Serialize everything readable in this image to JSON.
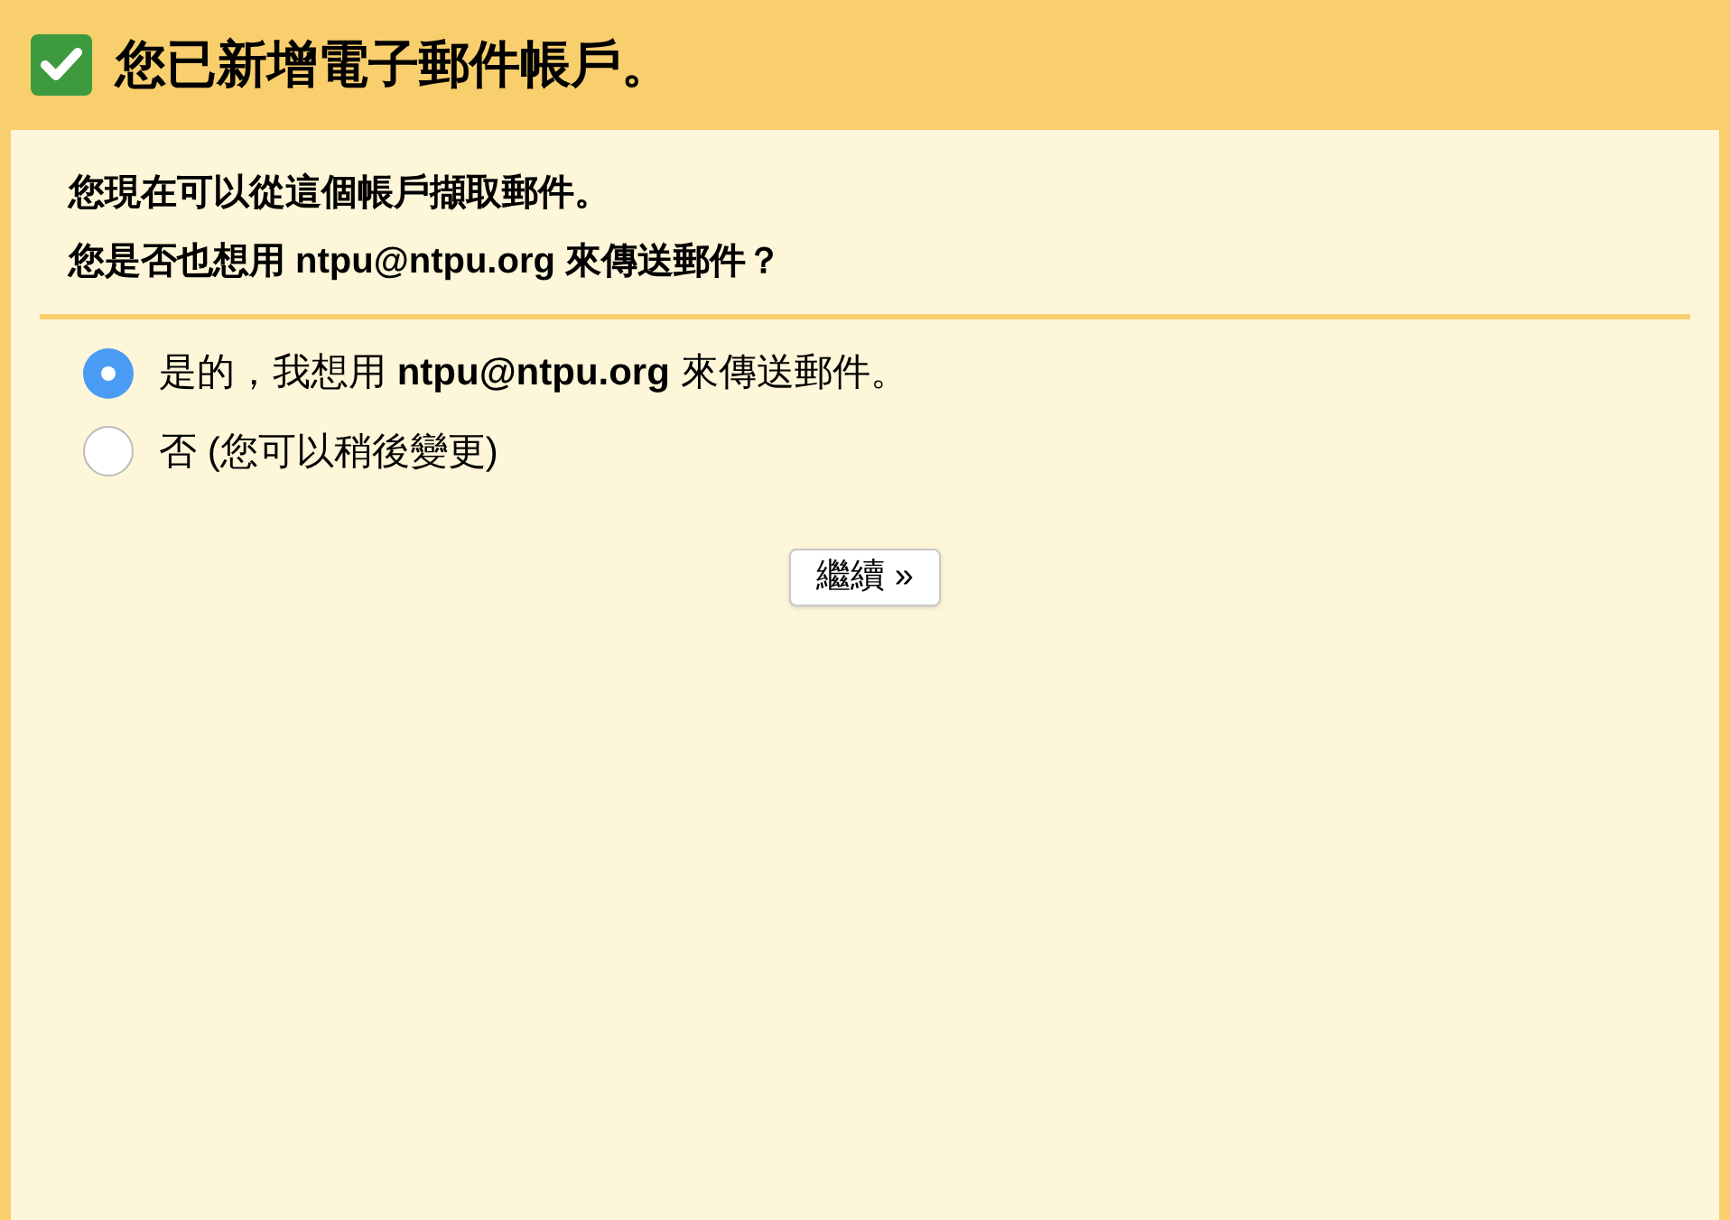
{
  "header": {
    "title": "您已新增電子郵件帳戶。"
  },
  "message": [
    "您現在可以從這個帳戶擷取郵件。",
    "您是否也想用 ntpu@ntpu.org 來傳送郵件？"
  ],
  "options": [
    {
      "label": "是的，我想用 **ntpu@ntpu.org** 來傳送郵件。",
      "selected": true
    },
    {
      "label": "否 (您可以稍後變更)",
      "selected": false
    }
  ],
  "button": {
    "label": "繼續 »"
  }
}
